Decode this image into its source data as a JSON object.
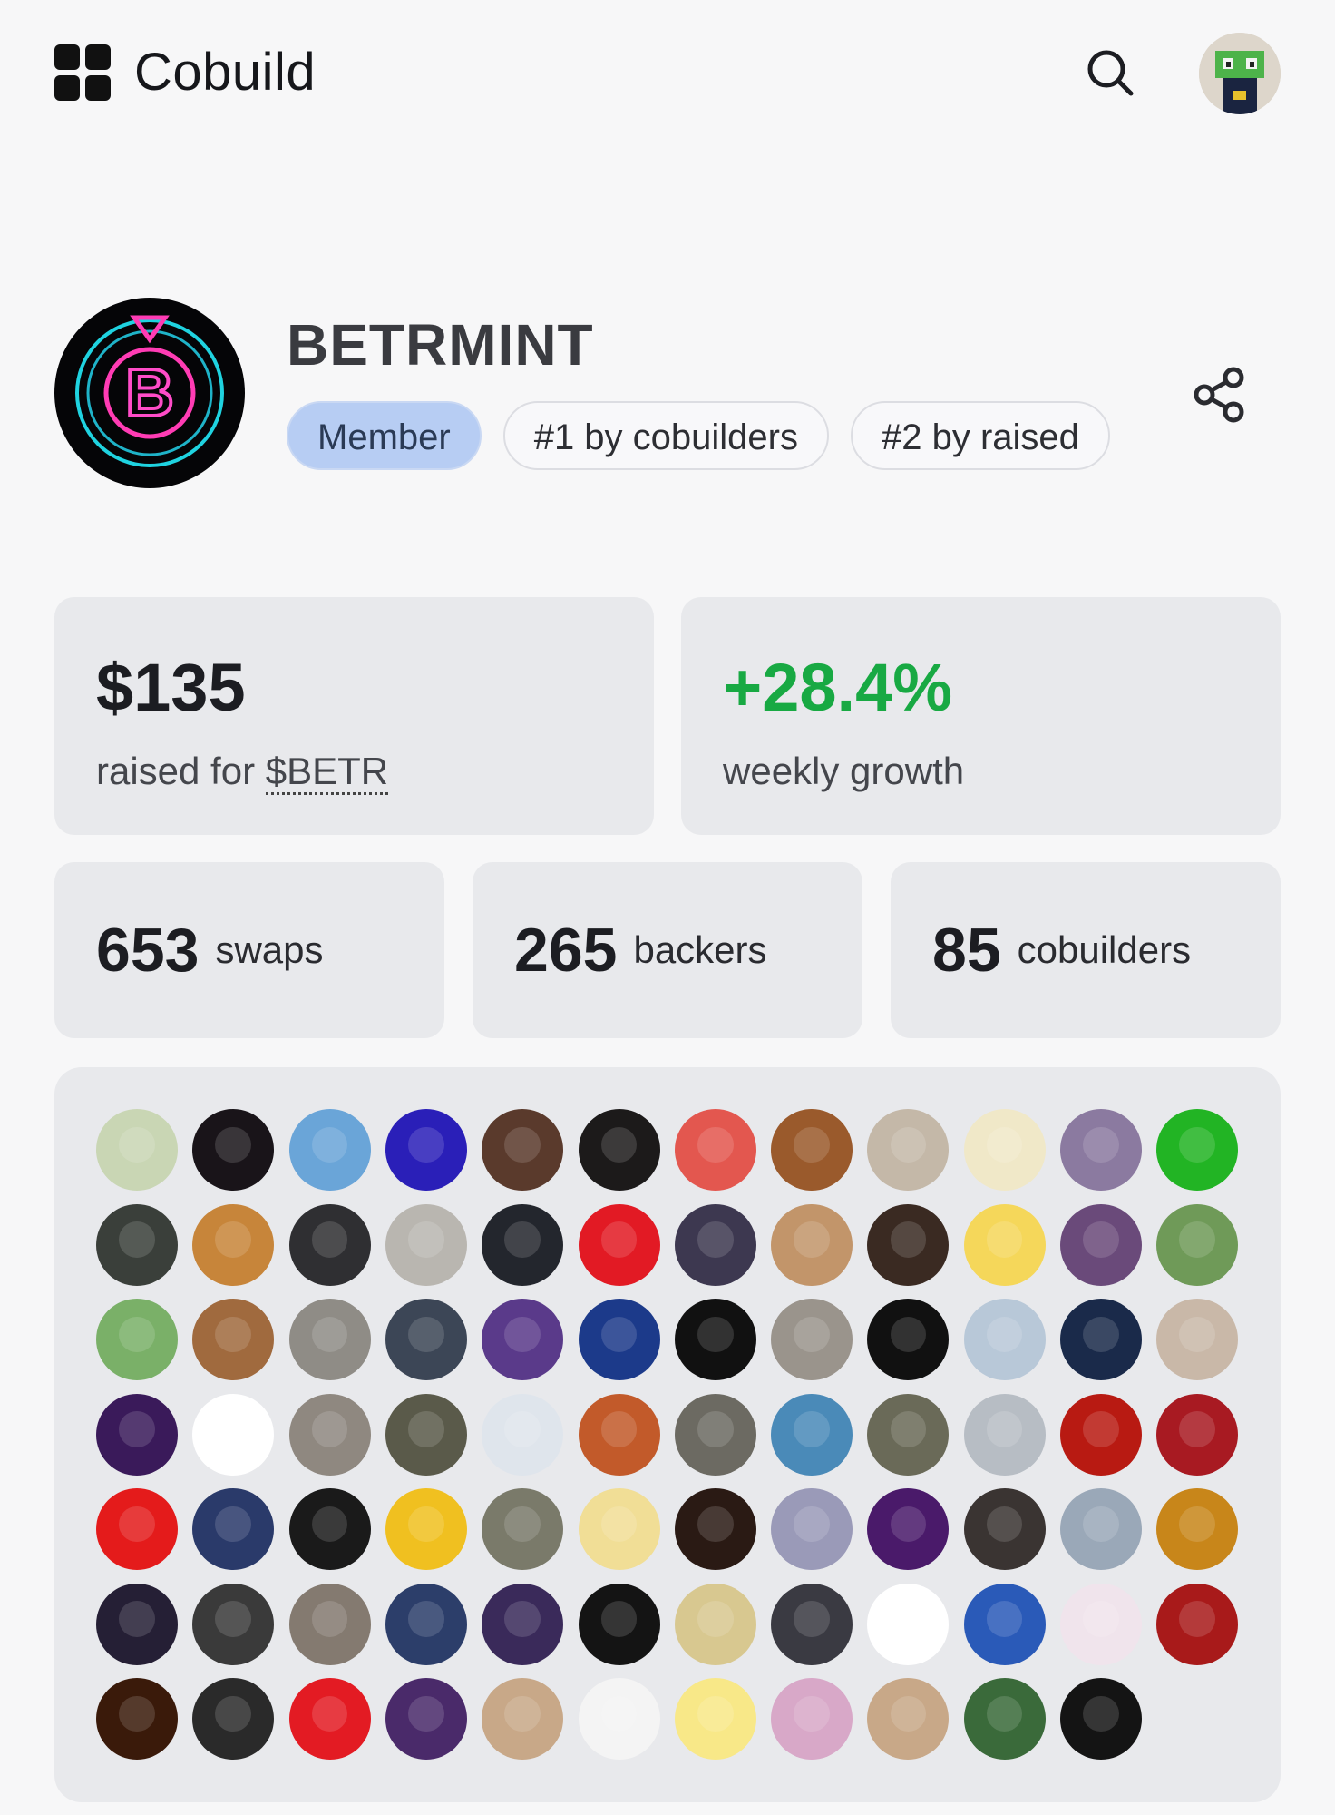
{
  "header": {
    "brand": "Cobuild",
    "search_icon": "search-icon",
    "avatar_icon": "user-avatar-frog"
  },
  "project": {
    "name": "BETRMINT",
    "badges": [
      "Member",
      "#1 by cobuilders",
      "#2 by raised"
    ],
    "share_icon": "share-icon"
  },
  "stats": {
    "raised_value": "$135",
    "raised_prefix": "raised for ",
    "raised_token": "$BETR",
    "growth_value": "+28.4%",
    "growth_label": "weekly growth",
    "swaps_value": "653",
    "swaps_label": "swaps",
    "backers_value": "265",
    "backers_label": "backers",
    "cobuilders_value": "85",
    "cobuilders_label": "cobuilders"
  },
  "colors": {
    "accent_green": "#18a943",
    "member_badge": "#b7cdf3",
    "card_bg": "#e8e9ec"
  },
  "cobuilder_avatars": [
    "#c9d6b4",
    "#191419",
    "#6aa5d8",
    "#2a1fb8",
    "#5a3a2c",
    "#1c1a1a",
    "#e3574f",
    "#9a5a2c",
    "#c4b8a8",
    "#f0e8c8",
    "#8b7aa0",
    "#22b424",
    "#3a3f3a",
    "#c7853a",
    "#2f2f32",
    "#b9b6b0",
    "#23262d",
    "#e21a24",
    "#3d3850",
    "#c2956a",
    "#3a2a22",
    "#f5d75a",
    "#6a4a7a",
    "#6f9a58",
    "#7ab068",
    "#a06a3e",
    "#8f8c86",
    "#3c4656",
    "#5a3a8a",
    "#1c3a8a",
    "#111111",
    "#9a948c",
    "#111111",
    "#b8c8d8",
    "#1a2a4a",
    "#c9b8a8",
    "#3a1a5a",
    "#ffffff",
    "#8f8880",
    "#5a5a4a",
    "#dfe5ec",
    "#c25a2a",
    "#6c6a62",
    "#4a8ab8",
    "#6a6a58",
    "#b7bdc4",
    "#b81a12",
    "#a81a22",
    "#e41b1b",
    "#2a3a6a",
    "#1a1a1a",
    "#f0c020",
    "#7a7a6a",
    "#f1de96",
    "#2a1a14",
    "#9a9ab8",
    "#4a1a6a",
    "#3a3432",
    "#9aa8b8",
    "#c8861a",
    "#251f35",
    "#3a3a3a",
    "#847a70",
    "#2c3e6a",
    "#3a2a5a",
    "#141414",
    "#d8c890",
    "#3a3a42",
    "#ffffff",
    "#2a5ab8",
    "#f0e4ec",
    "#a81a1a",
    "#3a1a0a",
    "#2a2a2a",
    "#e31b23",
    "#4a2a6a",
    "#c8a888",
    "#f4f4f4",
    "#f8e888",
    "#d8a8c8",
    "#c8a888",
    "#3a6a3a",
    "#141414"
  ]
}
